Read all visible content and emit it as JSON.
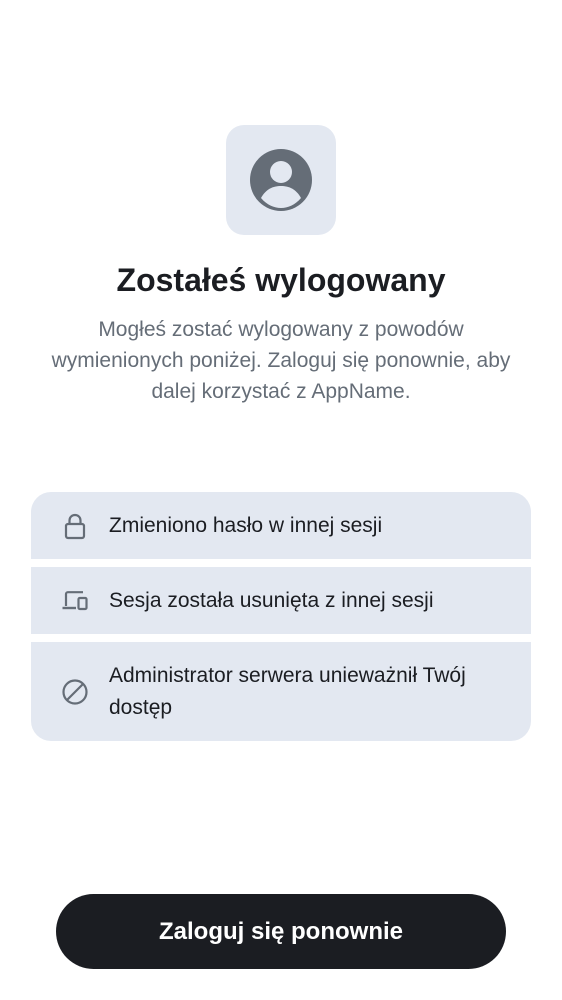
{
  "header": {
    "avatar_icon": "user-avatar-icon",
    "title": "Zostałeś wylogowany",
    "subtitle": "Mogłeś zostać wylogowany z powodów wymienionych poniżej. Zaloguj się ponownie, aby dalej korzystać z AppName."
  },
  "reasons": [
    {
      "icon": "lock-icon",
      "label": "Zmieniono hasło w innej sesji"
    },
    {
      "icon": "devices-icon",
      "label": "Sesja została usunięta z innej sesji"
    },
    {
      "icon": "block-icon",
      "label": "Administrator serwera unieważnił Twój dostęp"
    }
  ],
  "actions": {
    "login_label": "Zaloguj się ponownie"
  },
  "colors": {
    "card_background": "#e3e8f1",
    "icon_gray": "#656d77",
    "button_background": "#1b1d22",
    "button_text": "#ffffff"
  }
}
